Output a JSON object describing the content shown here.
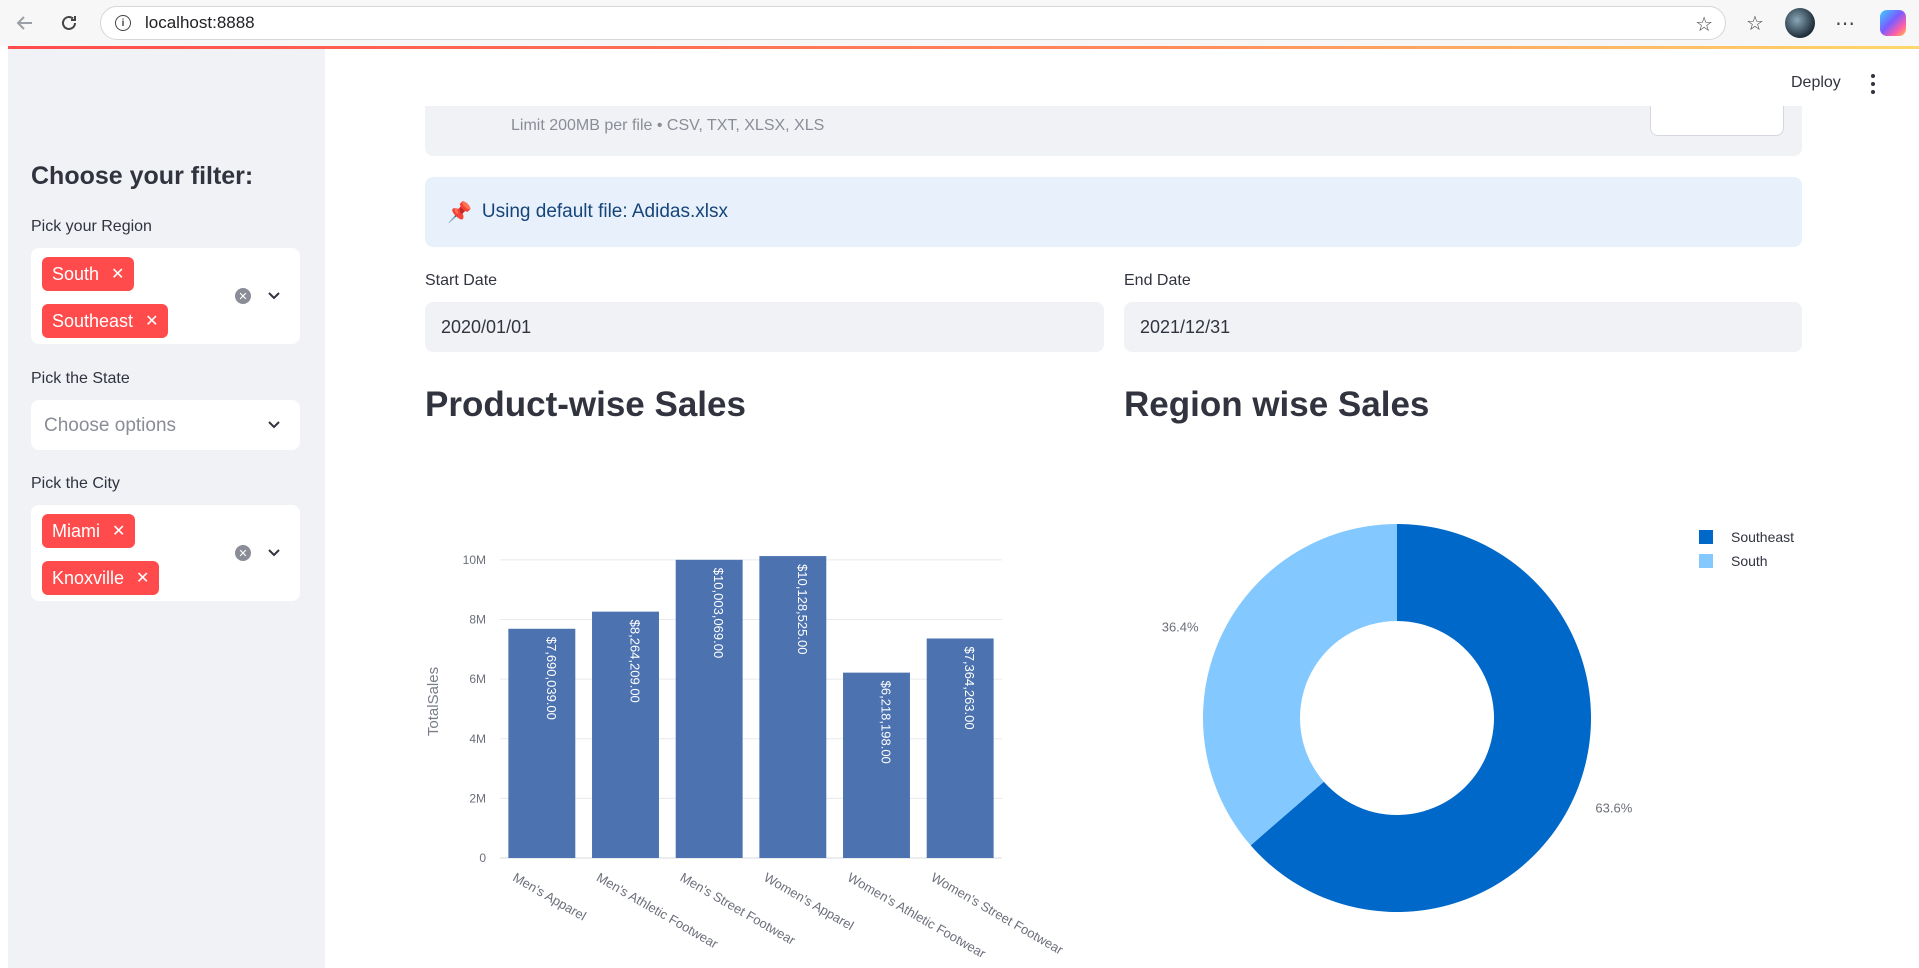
{
  "browser": {
    "url": "localhost:8888"
  },
  "sidebar": {
    "title": "Choose your filter:",
    "region": {
      "label": "Pick your Region",
      "selected": [
        "South",
        "Southeast"
      ]
    },
    "state": {
      "label": "Pick the State",
      "placeholder": "Choose options"
    },
    "city": {
      "label": "Pick the City",
      "selected": [
        "Miami",
        "Knoxville"
      ]
    }
  },
  "header": {
    "deploy_label": "Deploy"
  },
  "uploader": {
    "limit_text": "Limit 200MB per file • CSV, TXT, XLSX, XLS"
  },
  "info": {
    "icon": "pushpin-icon",
    "text": "Using default file: Adidas.xlsx"
  },
  "dates": {
    "start_label": "Start Date",
    "start_value": "2020/01/01",
    "end_label": "End Date",
    "end_value": "2021/12/31"
  },
  "sections": {
    "product_title": "Product-wise Sales",
    "region_title": "Region wise Sales"
  },
  "chart_data": [
    {
      "type": "bar",
      "categories": [
        "Men's Apparel",
        "Men's Athletic Footwear",
        "Men's Street Footwear",
        "Women's Apparel",
        "Women's Athletic Footwear",
        "Women's Street Footwear"
      ],
      "values": [
        7690039,
        8264209,
        10003069,
        10128525,
        6218198,
        7364263
      ],
      "data_labels": [
        "$7,690,039.00",
        "$8,264,209.00",
        "$10,003,069.00",
        "$10,128,525.00",
        "$6,218,198.00",
        "$7,364,263.00"
      ],
      "ylabel": "TotalSales",
      "ylim": [
        0,
        10500000
      ],
      "yticks": [
        0,
        2000000,
        4000000,
        6000000,
        8000000,
        10000000
      ],
      "ytick_labels": [
        "0",
        "2M",
        "4M",
        "6M",
        "8M",
        "10M"
      ],
      "grid": true,
      "color": "#4c72b0"
    },
    {
      "type": "pie",
      "donut": true,
      "labels": [
        "Southeast",
        "South"
      ],
      "values": [
        63.6,
        36.4
      ],
      "percent_labels": [
        "63.6%",
        "36.4%"
      ],
      "colors": [
        "#0068c9",
        "#83c9ff"
      ],
      "legend_position": "top-right"
    }
  ]
}
